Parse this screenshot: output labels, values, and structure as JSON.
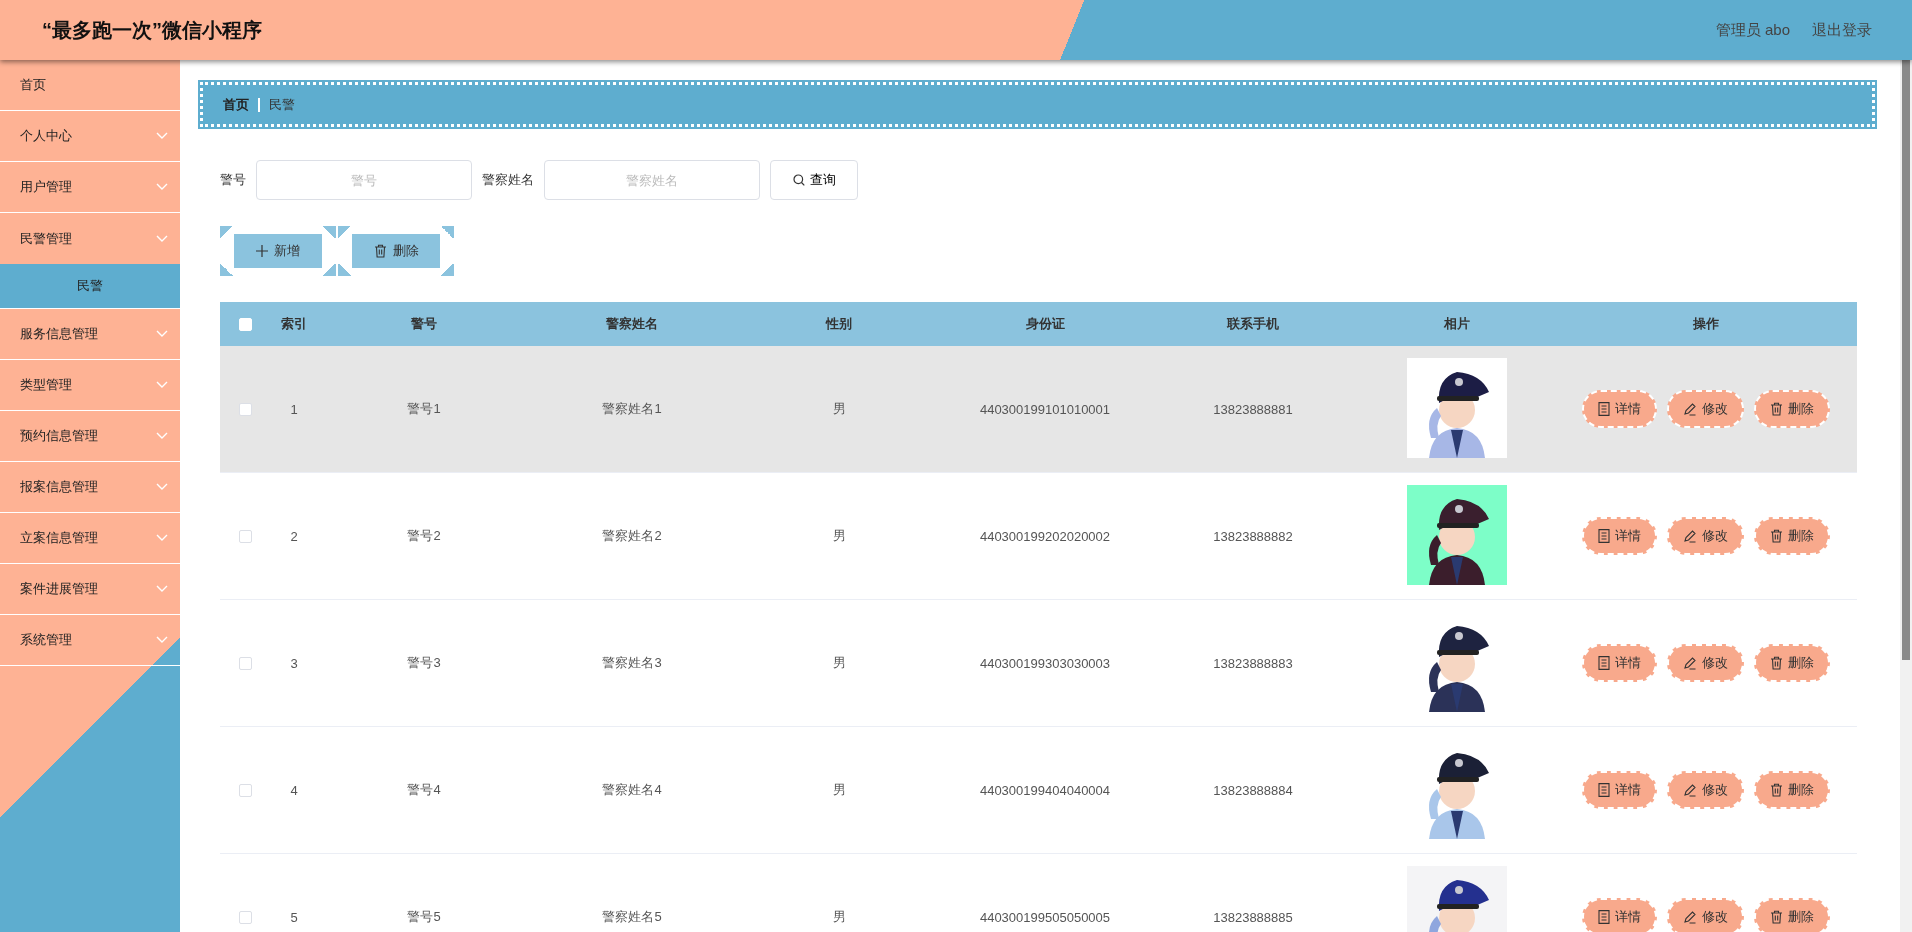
{
  "header": {
    "title": "“最多跑一次”微信小程序",
    "user": "管理员 abo",
    "logout": "退出登录"
  },
  "sidebar": {
    "items": [
      {
        "label": "首页",
        "kind": "link"
      },
      {
        "label": "个人中心",
        "kind": "menu",
        "expanded": false
      },
      {
        "label": "用户管理",
        "kind": "menu",
        "expanded": false
      },
      {
        "label": "民警管理",
        "kind": "menu",
        "expanded": true,
        "children": [
          {
            "label": "民警",
            "selected": true
          }
        ]
      },
      {
        "label": "服务信息管理",
        "kind": "menu",
        "expanded": false
      },
      {
        "label": "类型管理",
        "kind": "menu",
        "expanded": false
      },
      {
        "label": "预约信息管理",
        "kind": "menu",
        "expanded": false
      },
      {
        "label": "报案信息管理",
        "kind": "menu",
        "expanded": false
      },
      {
        "label": "立案信息管理",
        "kind": "menu",
        "expanded": false
      },
      {
        "label": "案件进展管理",
        "kind": "menu",
        "expanded": false
      },
      {
        "label": "系统管理",
        "kind": "menu",
        "expanded": false
      }
    ]
  },
  "breadcrumb": [
    "首页",
    "民警"
  ],
  "search": {
    "fields": [
      {
        "label": "警号",
        "placeholder": "警号"
      },
      {
        "label": "警察姓名",
        "placeholder": "警察姓名"
      }
    ],
    "button": "查询"
  },
  "toolbar": [
    {
      "label": "新增",
      "kind": "add"
    },
    {
      "label": "删除",
      "kind": "delete"
    }
  ],
  "table": {
    "select_all": {
      "checked": false
    },
    "columns": [
      "索引",
      "警号",
      "警察姓名",
      "性别",
      "身份证",
      "联系手机",
      "相片",
      "操作"
    ],
    "rows": [
      {
        "checked": false,
        "hovered": true,
        "index": "1",
        "badge_no": "警号1",
        "name": "警察姓名1",
        "sex": "男",
        "id_card": "440300199101010001",
        "phone": "13823888881",
        "actions": [
          {
            "label": "详情",
            "kind": "detail"
          },
          {
            "label": "修改",
            "kind": "edit"
          },
          {
            "label": "删除",
            "kind": "delete"
          }
        ]
      },
      {
        "checked": false,
        "hovered": false,
        "index": "2",
        "badge_no": "警号2",
        "name": "警察姓名2",
        "sex": "男",
        "id_card": "440300199202020002",
        "phone": "13823888882",
        "actions": [
          {
            "label": "详情",
            "kind": "detail"
          },
          {
            "label": "修改",
            "kind": "edit"
          },
          {
            "label": "删除",
            "kind": "delete"
          }
        ]
      },
      {
        "checked": false,
        "hovered": false,
        "index": "3",
        "badge_no": "警号3",
        "name": "警察姓名3",
        "sex": "男",
        "id_card": "440300199303030003",
        "phone": "13823888883",
        "actions": [
          {
            "label": "详情",
            "kind": "detail"
          },
          {
            "label": "修改",
            "kind": "edit"
          },
          {
            "label": "删除",
            "kind": "delete"
          }
        ]
      },
      {
        "checked": false,
        "hovered": false,
        "index": "4",
        "badge_no": "警号4",
        "name": "警察姓名4",
        "sex": "男",
        "id_card": "440300199404040004",
        "phone": "13823888884",
        "actions": [
          {
            "label": "详情",
            "kind": "detail"
          },
          {
            "label": "修改",
            "kind": "edit"
          },
          {
            "label": "删除",
            "kind": "delete"
          }
        ]
      },
      {
        "checked": false,
        "hovered": false,
        "index": "5",
        "badge_no": "警号5",
        "name": "警察姓名5",
        "sex": "男",
        "id_card": "440300199505050005",
        "phone": "13823888885",
        "actions": [
          {
            "label": "详情",
            "kind": "detail"
          },
          {
            "label": "修改",
            "kind": "edit"
          },
          {
            "label": "删除",
            "kind": "delete"
          }
        ]
      }
    ]
  }
}
